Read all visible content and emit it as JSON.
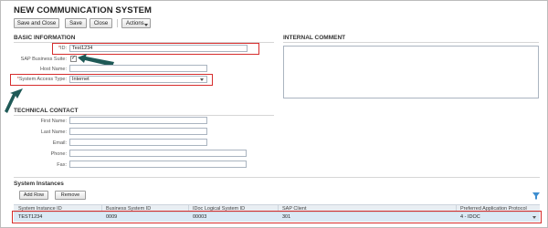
{
  "page": {
    "title": "NEW COMMUNICATION SYSTEM"
  },
  "toolbar": {
    "save_close": "Save and Close",
    "save": "Save",
    "close": "Close",
    "actions": "Actions"
  },
  "basic_info": {
    "heading": "BASIC INFORMATION",
    "id_label": "ID:",
    "id_value": "Test1234",
    "sap_suite_label": "SAP Business Suite:",
    "sap_suite_checked": "✓",
    "host_label": "Host Name:",
    "host_value": "",
    "access_label": "System Access Type:",
    "access_value": "Internet"
  },
  "internal_comment": {
    "heading": "INTERNAL COMMENT",
    "value": ""
  },
  "technical_contact": {
    "heading": "TECHNICAL CONTACT",
    "first_name_label": "First Name:",
    "last_name_label": "Last Name:",
    "email_label": "Email:",
    "phone_label": "Phone:",
    "fax_label": "Fax:"
  },
  "system_instances": {
    "heading": "System Instances",
    "add_row": "Add Row",
    "remove": "Remove",
    "columns": [
      "System Instance ID",
      "Business System ID",
      "IDoc Logical System ID",
      "SAP Client",
      "Preferred Application Protocol"
    ],
    "rows": [
      [
        "TEST1234",
        "0009",
        "00003",
        "301",
        "4 - IDOC"
      ]
    ]
  },
  "colors": {
    "highlight_border": "#d62d2d",
    "arrow": "#1f5a57",
    "row_selected": "#dbe9f5"
  },
  "icons": [
    "filter-icon",
    "checkmark-icon",
    "dropdown-caret-icon",
    "pointer-arrow-icon"
  ]
}
